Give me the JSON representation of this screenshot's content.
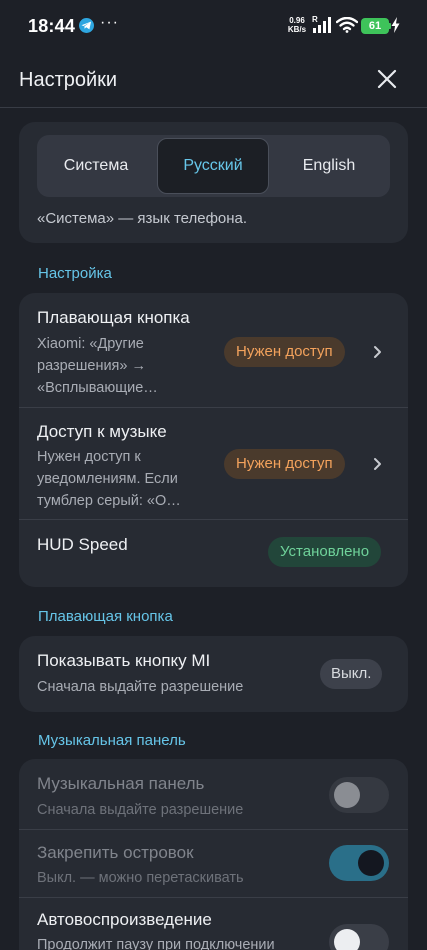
{
  "status_bar": {
    "time": "18:44",
    "more": "···",
    "net_speed_value": "0.96",
    "net_speed_unit": "KB/s",
    "signal_label": "R",
    "battery": "61"
  },
  "header": {
    "title": "Настройки"
  },
  "language": {
    "options": [
      "Система",
      "Русский",
      "English"
    ],
    "selected": "Русский",
    "note": "«Система» — язык телефона."
  },
  "sections": {
    "setup": "Настройка",
    "floating_button": "Плавающая кнопка",
    "music_panel": "Музыкальная панель"
  },
  "setup_rows": [
    {
      "title": "Плавающая кнопка",
      "subtitle": "Xiaomi: «Другие разрешения» → «Всплывающие…",
      "badge": "Нужен доступ"
    },
    {
      "title": "Доступ к музыке",
      "subtitle": "Нужен доступ к уведомлениям. Если тумблер серый: «О…",
      "badge": "Нужен доступ"
    },
    {
      "title": "HUD Speed",
      "badge": "Установлено"
    }
  ],
  "floating_rows": [
    {
      "title": "Показывать кнопку MI",
      "subtitle": "Сначала выдайте разрешение",
      "value": "Выкл."
    }
  ],
  "music_rows": [
    {
      "title": "Музыкальная панель",
      "subtitle": "Сначала выдайте разрешение",
      "toggle": false,
      "disabled": true
    },
    {
      "title": "Закрепить островок",
      "subtitle": "Выкл. — можно перетаскивать",
      "toggle": true,
      "disabled": true
    },
    {
      "title": "Автовоспроизведение",
      "subtitle": "Продолжит паузу при подключении",
      "toggle": false,
      "disabled": false
    }
  ],
  "colors": {
    "accent": "#66c5e8",
    "background": "#1d2027",
    "card": "#272b33",
    "warn": "#f3a25c",
    "ok": "#6fd29a",
    "battery": "#3ec35a"
  }
}
